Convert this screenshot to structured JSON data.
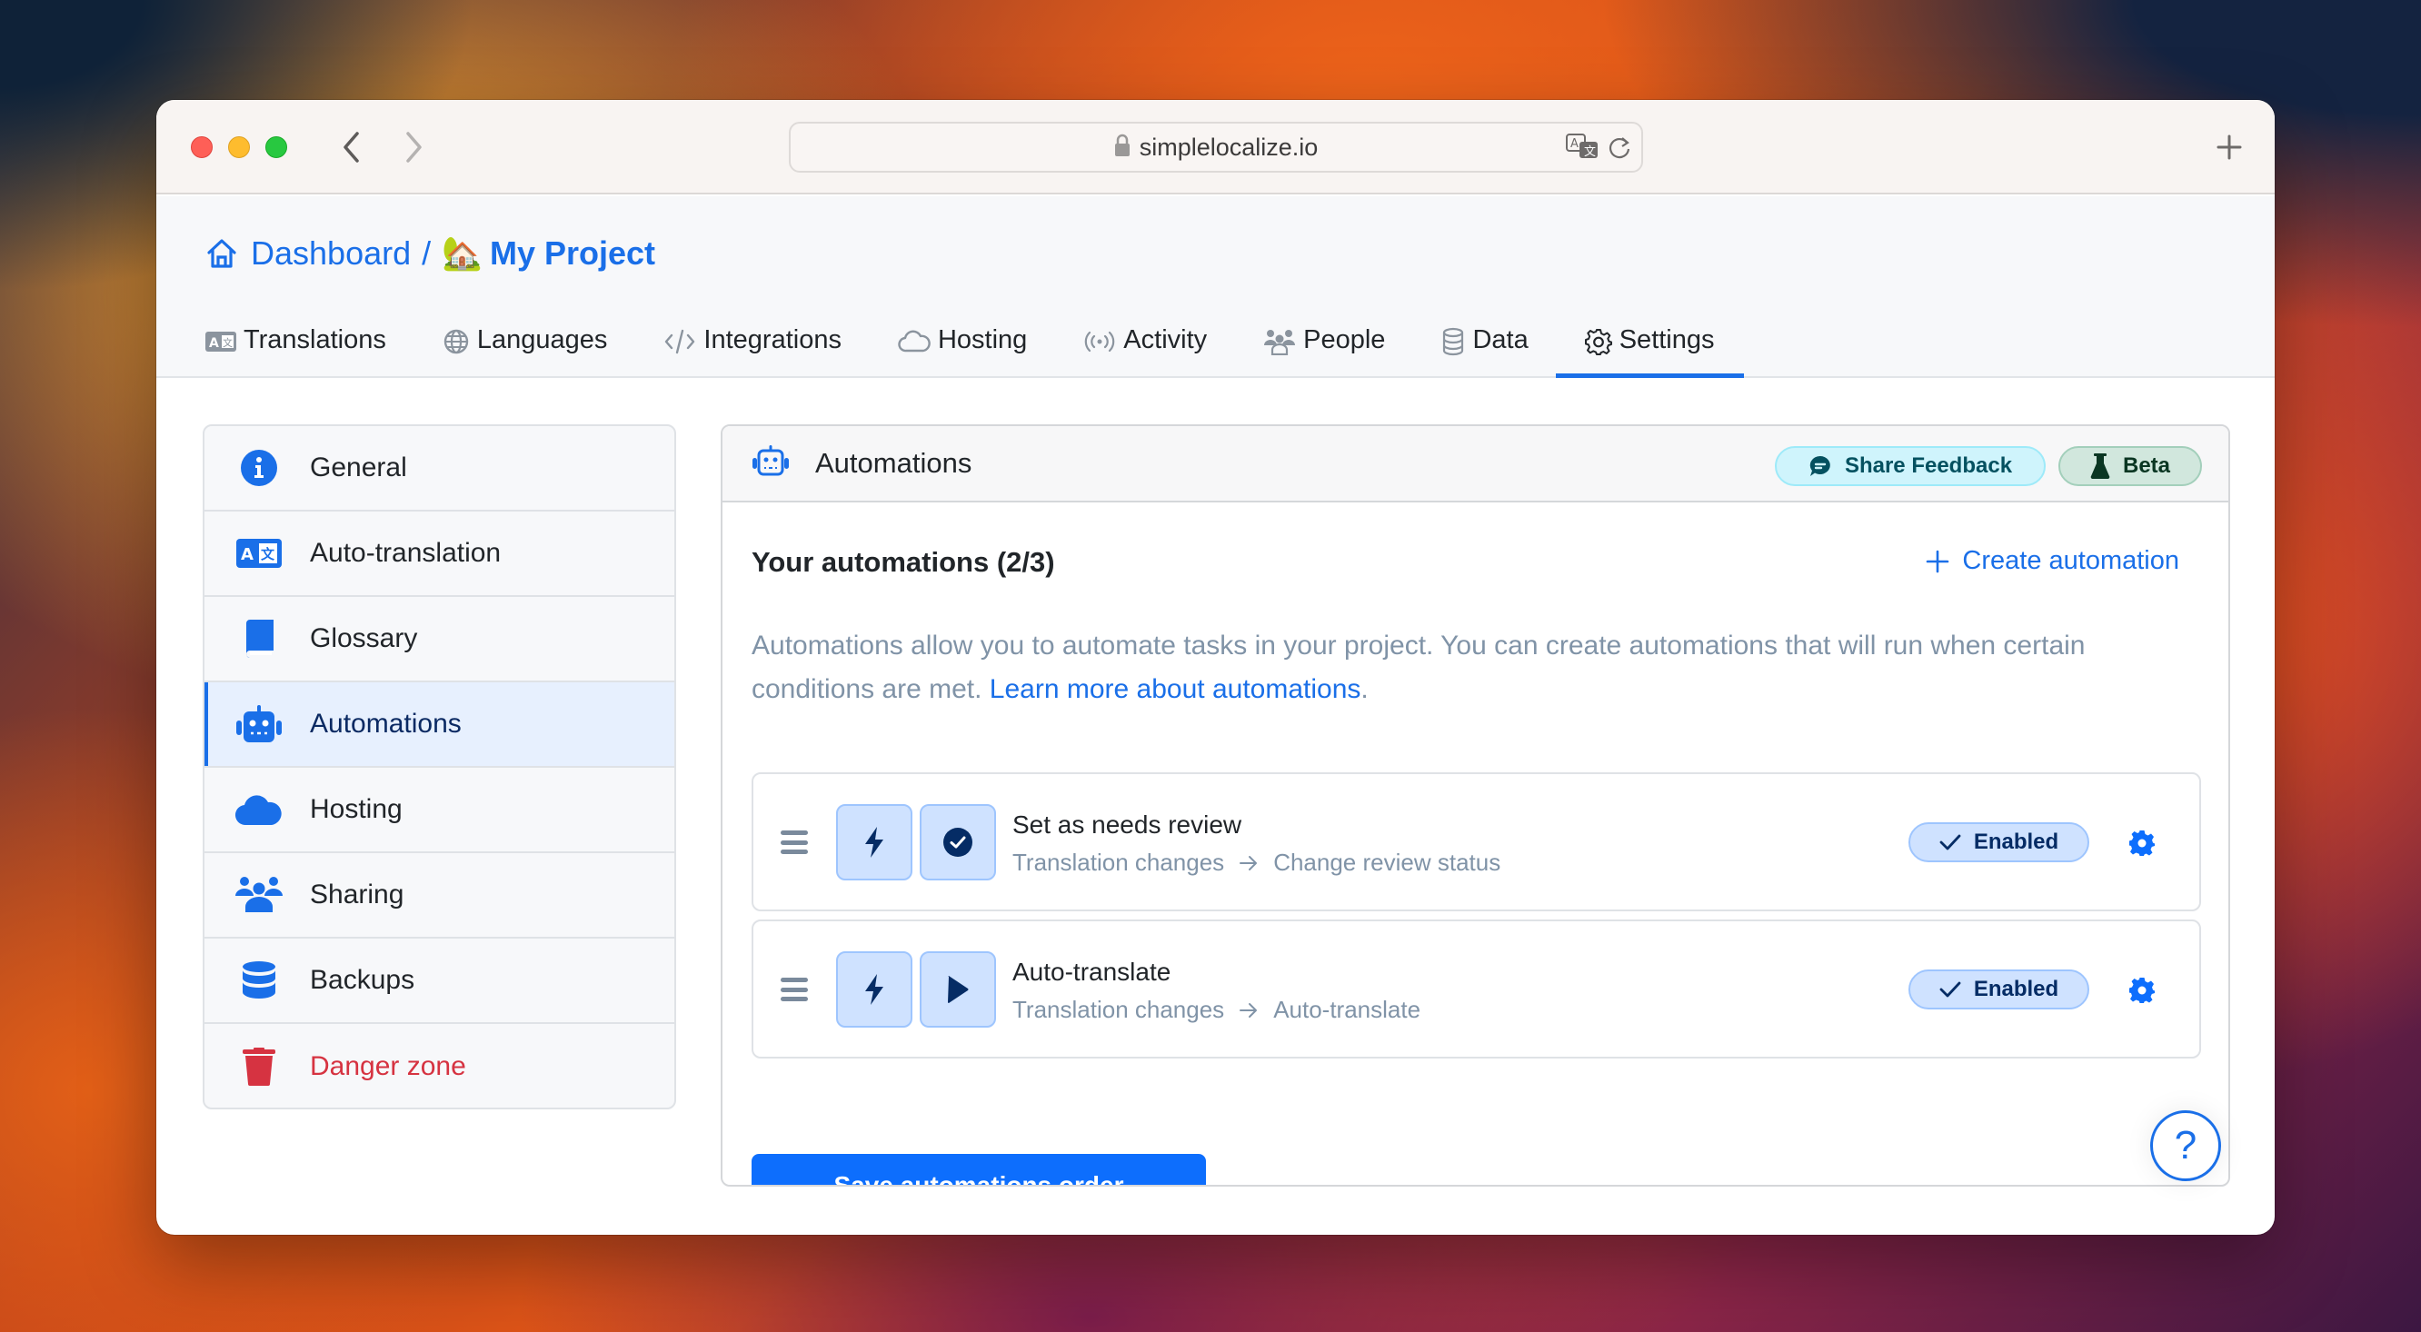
{
  "browser": {
    "url": "simplelocalize.io",
    "icons": [
      "back-icon",
      "forward-icon",
      "lock-icon",
      "translate-icon",
      "reload-icon",
      "new-tab-icon"
    ]
  },
  "breadcrumb": {
    "home_label": "Dashboard",
    "separator": "/",
    "project_emoji": "🏡",
    "project_label": "My Project"
  },
  "tabs": [
    {
      "label": "Translations",
      "icon": "translate-icon",
      "active": false
    },
    {
      "label": "Languages",
      "icon": "globe-icon",
      "active": false
    },
    {
      "label": "Integrations",
      "icon": "code-icon",
      "active": false
    },
    {
      "label": "Hosting",
      "icon": "cloud-icon",
      "active": false
    },
    {
      "label": "Activity",
      "icon": "broadcast-icon",
      "active": false
    },
    {
      "label": "People",
      "icon": "people-icon",
      "active": false
    },
    {
      "label": "Data",
      "icon": "database-icon",
      "active": false
    },
    {
      "label": "Settings",
      "icon": "gear-icon",
      "active": true
    }
  ],
  "sidebar": {
    "items": [
      {
        "label": "General",
        "icon": "info-icon"
      },
      {
        "label": "Auto-translation",
        "icon": "translate-icon"
      },
      {
        "label": "Glossary",
        "icon": "book-icon"
      },
      {
        "label": "Automations",
        "icon": "robot-icon",
        "active": true
      },
      {
        "label": "Hosting",
        "icon": "cloud-icon"
      },
      {
        "label": "Sharing",
        "icon": "people-icon"
      },
      {
        "label": "Backups",
        "icon": "database-icon"
      },
      {
        "label": "Danger zone",
        "icon": "trash-icon",
        "danger": true
      }
    ]
  },
  "panel": {
    "title": "Automations",
    "feedback_label": "Share Feedback",
    "beta_label": "Beta",
    "section_title": "Your automations (2/3)",
    "create_label": "Create automation",
    "description": "Automations allow you to automate tasks in your project. You can create automations that will run when certain conditions are met. ",
    "learn_more_label": "Learn more about automations",
    "description_end": ".",
    "automations": [
      {
        "name": "Set as needs review",
        "trigger": "Translation changes",
        "action": "Change review status",
        "trigger_icon": "bolt-icon",
        "action_icon": "check-circle-icon",
        "status": "Enabled"
      },
      {
        "name": "Auto-translate",
        "trigger": "Translation changes",
        "action": "Auto-translate",
        "trigger_icon": "bolt-icon",
        "action_icon": "play-icon",
        "status": "Enabled"
      }
    ],
    "save_label": "Save automations order"
  },
  "help": {
    "label": "?"
  },
  "colors": {
    "accent": "#1a6fe8",
    "primary_button": "#0d6efd",
    "danger": "#d63341",
    "muted_text": "#8093a7"
  }
}
